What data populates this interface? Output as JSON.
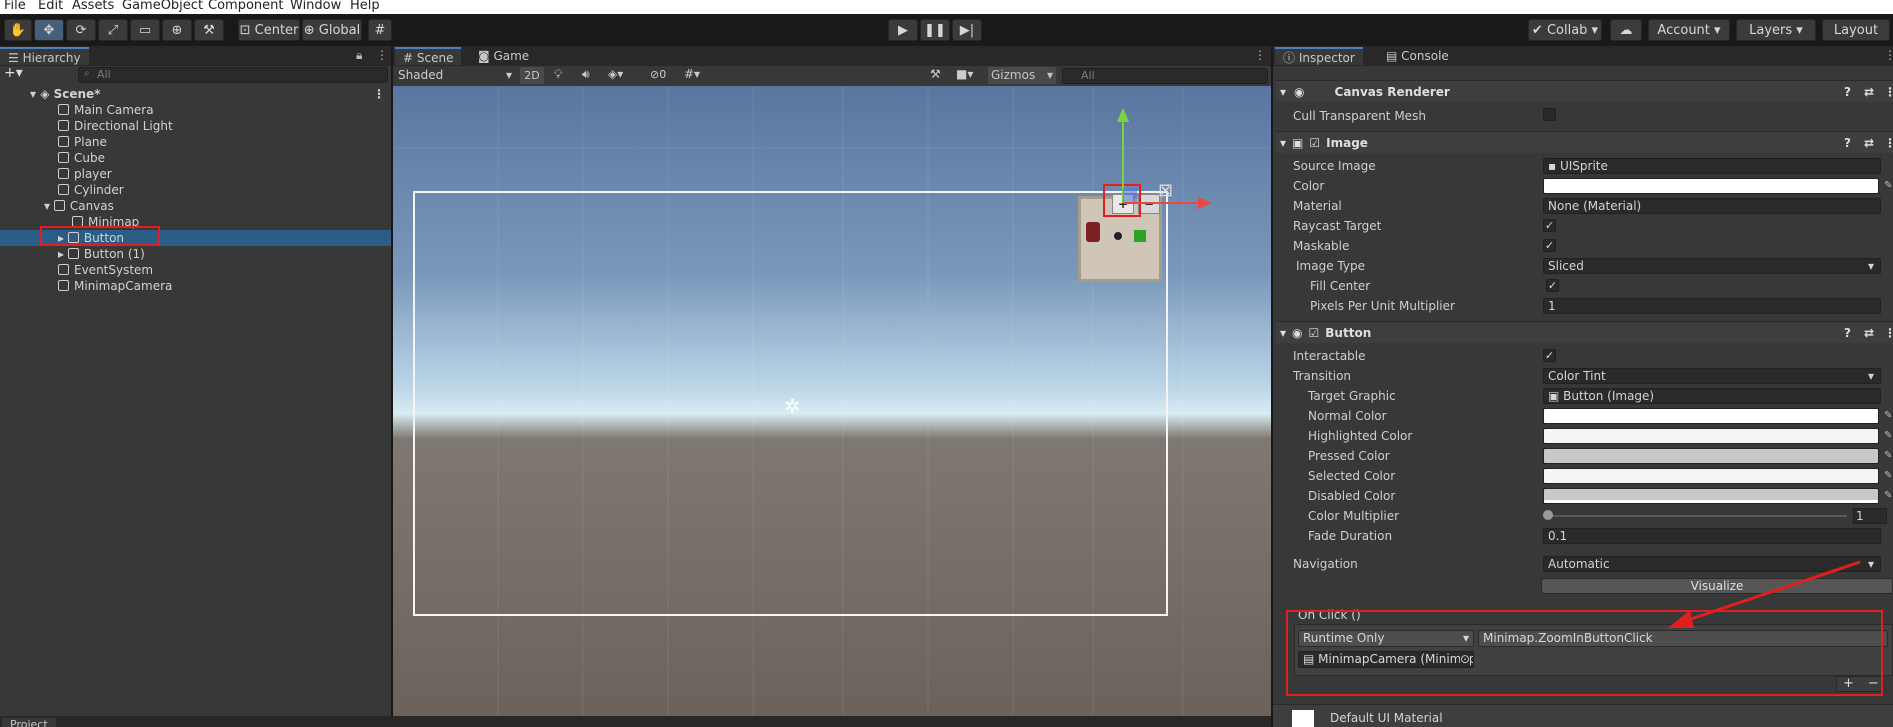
{
  "menu": [
    "File",
    "Edit",
    "Assets",
    "GameObject",
    "Component",
    "Window",
    "Help"
  ],
  "toolbar": {
    "center": "Center",
    "global": "Global",
    "collab": "Collab",
    "account": "Account",
    "layers": "Layers",
    "layout": "Layout"
  },
  "hierarchy": {
    "tab": "Hierarchy",
    "search": "All",
    "scene": "Scene*",
    "items": [
      "Main Camera",
      "Directional Light",
      "Plane",
      "Cube",
      "player",
      "Cylinder",
      "Canvas",
      "Minimap",
      "Button",
      "Button (1)",
      "EventSystem",
      "MinimapCamera"
    ]
  },
  "scene": {
    "tab_scene": "Scene",
    "tab_game": "Game",
    "shading": "Shaded",
    "mode2d": "2D",
    "count": "0",
    "gizmos": "Gizmos",
    "search": "All"
  },
  "inspector": {
    "tab": "Inspector",
    "console": "Console",
    "canvas_renderer": "Canvas Renderer",
    "cull": "Cull Transparent Mesh",
    "image": "Image",
    "source_image_label": "Source Image",
    "source_image": "UISprite",
    "color_label": "Color",
    "material_label": "Material",
    "material": "None (Material)",
    "raycast": "Raycast Target",
    "maskable": "Maskable",
    "image_type_label": "Image Type",
    "image_type": "Sliced",
    "fill_center": "Fill Center",
    "ppu_label": "Pixels Per Unit Multiplier",
    "ppu": "1",
    "button": "Button",
    "interactable": "Interactable",
    "transition_label": "Transition",
    "transition": "Color Tint",
    "target_graphic_label": "Target Graphic",
    "target_graphic": "Button (Image)",
    "normal": "Normal Color",
    "highlighted": "Highlighted Color",
    "pressed": "Pressed Color",
    "selected": "Selected Color",
    "disabled": "Disabled Color",
    "multiplier_label": "Color Multiplier",
    "multiplier": "1",
    "fade_label": "Fade Duration",
    "fade": "0.1",
    "navigation_label": "Navigation",
    "navigation": "Automatic",
    "visualize": "Visualize",
    "onclick": "On Click ()",
    "runtime": "Runtime Only",
    "function": "Minimap.ZoomInButtonClick",
    "target_obj": "MinimapCamera (Minimap",
    "default_mat": "Default UI Material"
  },
  "project_tab": "Project",
  "colors": {
    "accent": "#4c7fc1",
    "selection": "#2c5d87",
    "annotation": "#e02020"
  }
}
